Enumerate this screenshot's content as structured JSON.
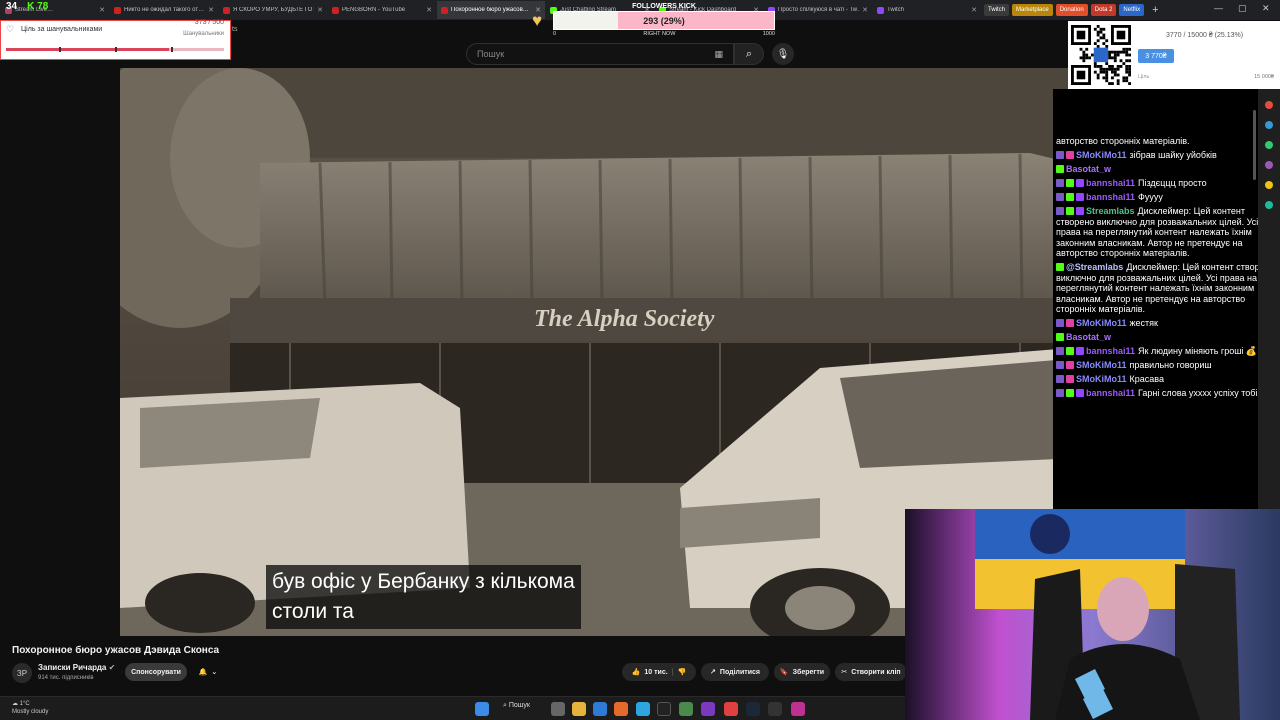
{
  "stats": {
    "value_a": "34",
    "value_b": "78"
  },
  "browser": {
    "tabs": [
      {
        "title": "Stream Live…",
        "color": "#aa4466",
        "active": false
      },
      {
        "title": "Никто не ожидал такого от…",
        "color": "#cc2222",
        "active": false
      },
      {
        "title": "Я СКОРО УМРУ, БУДЬТЕ ГОТ…",
        "color": "#cc2222",
        "active": false
      },
      {
        "title": "PENGBORN - YouTube",
        "color": "#cc2222",
        "active": false
      },
      {
        "title": "Похоронное бюро ужасов…",
        "color": "#cc2222",
        "active": true
      },
      {
        "title": "Just Chatting Stream",
        "color": "#53fc18",
        "active": false
      },
      {
        "title": "Stream - Kick Dashboard",
        "color": "#53fc18",
        "active": false
      },
      {
        "title": "Просто спілкуюся в чаті - Tw…",
        "color": "#9146ff",
        "active": false
      },
      {
        "title": "Twitch",
        "color": "#9146ff",
        "active": false
      }
    ],
    "pills": [
      {
        "label": "Twitch",
        "color": "#3a3a3a"
      },
      {
        "label": "Marketplace",
        "color": "#b8860b"
      },
      {
        "label": "Donation",
        "color": "#e04e2a"
      },
      {
        "label": "Dota 2",
        "color": "#c0392b"
      },
      {
        "label": "Netflix",
        "color": "#2b66c9"
      }
    ]
  },
  "subgoal": {
    "title": "Ціль за шанувальниками",
    "count": "373 / 500",
    "unit": "Шанувальники",
    "progress": 0.746
  },
  "followers_goal": {
    "title": "FOLLOWERS KICK",
    "value": "293 (29%)",
    "progress": 0.29,
    "min": "0",
    "center": "RIGHT NOW",
    "max": "1000"
  },
  "donation": {
    "summary": "3770 / 15000 ₴ (25.13%)",
    "button": "3 770₴",
    "left_label": "Ціль",
    "right_label": "15 000₴"
  },
  "youtube": {
    "search_placeholder": "Пошук",
    "partial_text": "ts",
    "caption_line1": "був офіс у Бербанку з кількома",
    "caption_line2": "столи та",
    "video_title": "Похоронное бюро ужасов Дэвида Сконса",
    "channel_avatar": "ЗР",
    "channel_name": "Записки Ричарда",
    "channel_subs": "914 тис. підписників",
    "sponsor_label": "Спонсорувати",
    "like_count": "10 тис.",
    "share_label": "Поділитися",
    "save_label": "Зберегти",
    "clip_label": "Створити кліп"
  },
  "chat": {
    "messages": [
      {
        "user": "",
        "text": "авторство сторонніх матеріалів.",
        "color": "#ffffff",
        "badges": []
      },
      {
        "user": "SMoKiMo11",
        "text": "зібрав шайку уйобків",
        "color": "#8a8aff",
        "badges": [
          "#7a5ac8",
          "#e040a0"
        ]
      },
      {
        "user": "Basotat_w",
        "text": "",
        "color": "#a970ff",
        "badges": [
          "#53fc18"
        ]
      },
      {
        "user": "bannshai11",
        "text": "Піздєццц просто",
        "color": "#9b59ff",
        "badges": [
          "#7a5ac8",
          "#53fc18",
          "#9146ff"
        ]
      },
      {
        "user": "bannshai11",
        "text": "Фуууу",
        "color": "#9b59ff",
        "badges": [
          "#7a5ac8",
          "#53fc18",
          "#9146ff"
        ]
      },
      {
        "user": "Streamlabs",
        "text": "Дисклеймер: Цей контент створено виключно для розважальних цілей. Усі права на переглянутий контент належать їхнім законним власникам. Автор не претендує на авторство сторонніх матеріалів.",
        "color": "#4fc08d",
        "badges": [
          "#7a5ac8",
          "#53fc18",
          "#9146ff"
        ]
      },
      {
        "user": "@Streamlabs",
        "text": "Дисклеймер: Цей контент створено виключно для розважальних цілей. Усі права на переглянутий контент належать їхнім законним власникам. Автор не претендує на авторство сторонніх матеріалів.",
        "color": "#b8c4ff",
        "badges": [
          "#53fc18"
        ]
      },
      {
        "user": "SMoKiMo11",
        "text": "жестяк",
        "color": "#8a8aff",
        "badges": [
          "#7a5ac8",
          "#e040a0"
        ]
      },
      {
        "user": "Basotat_w",
        "text": "",
        "color": "#a970ff",
        "badges": [
          "#53fc18"
        ]
      },
      {
        "user": "bannshai11",
        "text": "Як людину міняють гроші 💰",
        "color": "#9b59ff",
        "badges": [
          "#7a5ac8",
          "#53fc18",
          "#9146ff"
        ]
      },
      {
        "user": "SMoKiMo11",
        "text": "правильно говориш",
        "color": "#8a8aff",
        "badges": [
          "#7a5ac8",
          "#e040a0"
        ]
      },
      {
        "user": "SMoKiMo11",
        "text": "Красава",
        "color": "#8a8aff",
        "badges": [
          "#7a5ac8",
          "#e040a0"
        ]
      },
      {
        "user": "bannshai11",
        "text": "Гарні слова ухххх успіху тобі 👏",
        "color": "#9b59ff",
        "badges": [
          "#7a5ac8",
          "#53fc18",
          "#9146ff"
        ]
      }
    ]
  },
  "taskbar": {
    "weather_temp": "1°C",
    "weather_desc": "Mostly cloudy",
    "search_label": "Пошук"
  }
}
